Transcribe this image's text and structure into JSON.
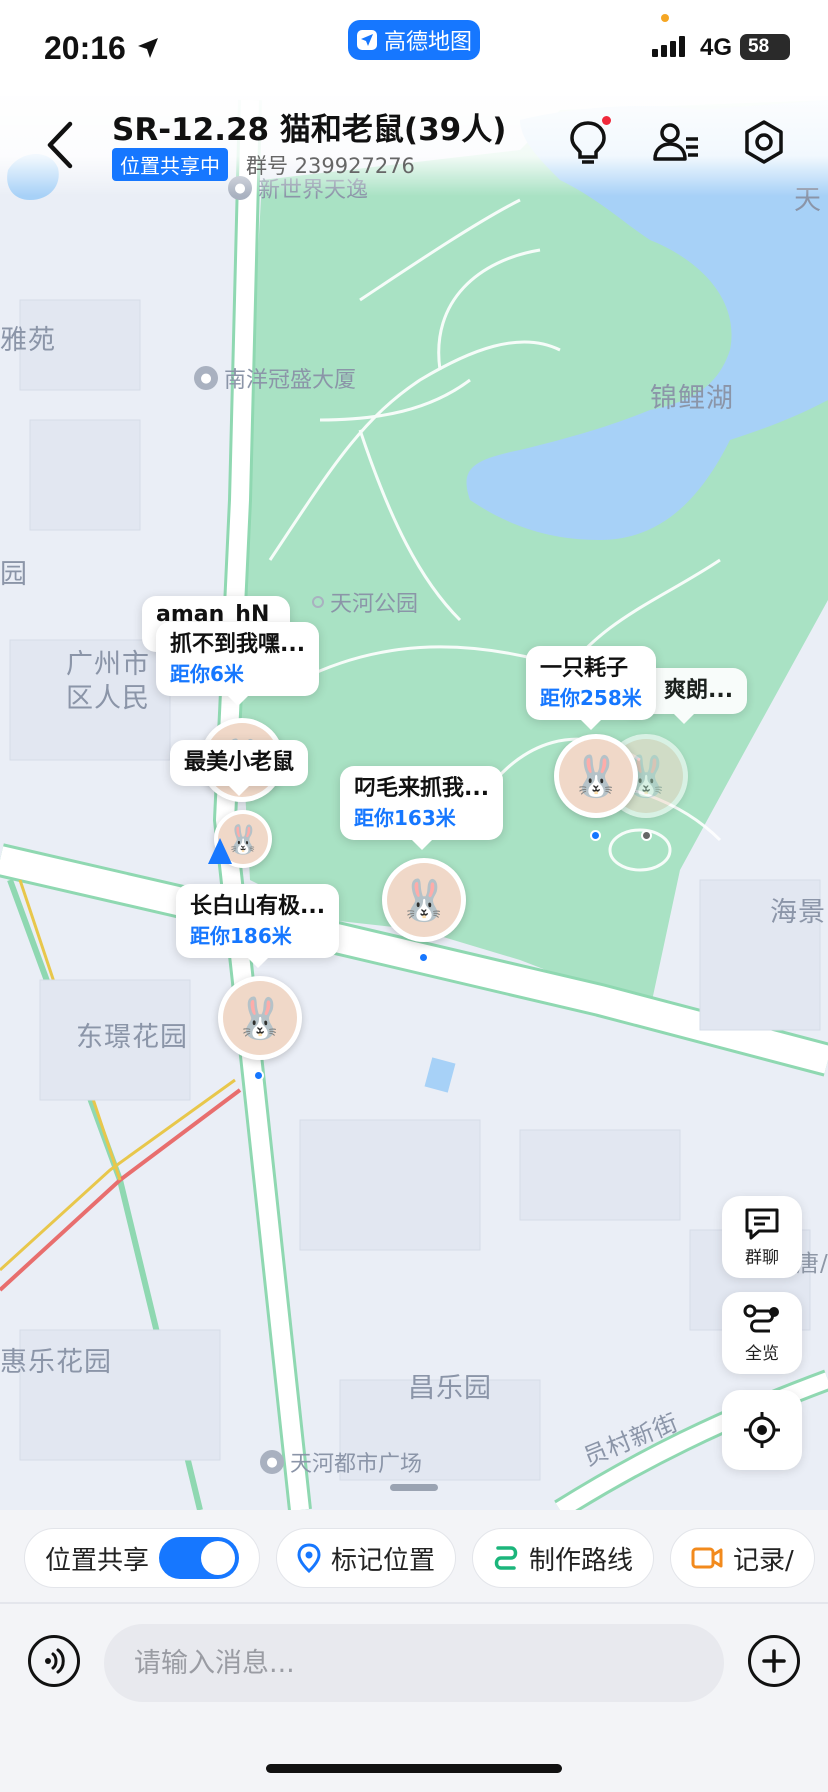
{
  "status_bar": {
    "time": "20:16",
    "app_name": "高德地图",
    "network": "4G",
    "battery": "58",
    "accent_color": "#1677ff"
  },
  "header": {
    "title": "SR-12.28 猫和老鼠(39人)",
    "share_status": "位置共享中",
    "group_number": "群号 239927276"
  },
  "map": {
    "labels": {
      "poi_xinshijie": "新世界天逸",
      "poi_nanyang": "南洋冠盛大厦",
      "lake": "锦鲤湖",
      "park": "天河公园",
      "district_1": "广州市",
      "district_2": "区人民",
      "dongjing": "东璟花园",
      "changle": "昌乐园",
      "huile": "惠乐花园",
      "tianhe_mall": "天河都市广场",
      "yuancun": "员村新街",
      "haijing": "海景",
      "yayuan": "雅苑",
      "tian_edge": "天",
      "tang_edge": "唐/",
      "left_edge": "园"
    },
    "members": [
      {
        "name": "aman_hN",
        "distance": ""
      },
      {
        "name": "抓不到我嘿...",
        "distance": "距你6米"
      },
      {
        "name": "最美小老鼠",
        "distance": ""
      },
      {
        "name": "叼毛来抓我...",
        "distance": "距你163米"
      },
      {
        "name": "长白山有极...",
        "distance": "距你186米"
      },
      {
        "name": "一只耗子",
        "distance": "距你258米"
      },
      {
        "name": "爽朗...",
        "distance": ""
      }
    ]
  },
  "side_buttons": {
    "group_chat": "群聊",
    "overview": "全览"
  },
  "bottom_panel": {
    "chips": {
      "location_share": "位置共享",
      "mark_location": "标记位置",
      "make_route": "制作路线",
      "record": "记录/"
    },
    "location_share_on": true,
    "message_placeholder": "请输入消息..."
  }
}
